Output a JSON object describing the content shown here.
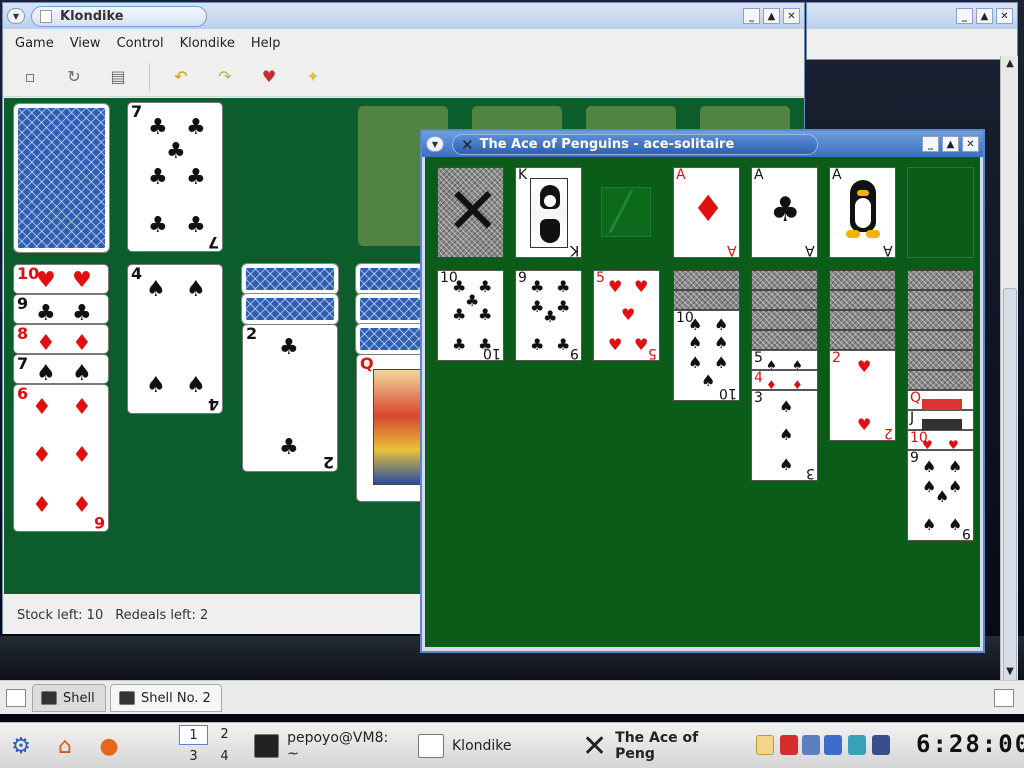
{
  "klondike": {
    "title": "Klondike",
    "menu": [
      "Game",
      "View",
      "Control",
      "Klondike",
      "Help"
    ],
    "toolbar_icons": [
      "new-game-icon",
      "restart-icon",
      "deal-icon",
      "undo-icon",
      "redo-icon",
      "hint-card-icon",
      "hint-bulb-icon"
    ],
    "status": {
      "stock": "Stock left: 10",
      "redeals": "Redeals left: 2"
    }
  },
  "ace": {
    "title": "The Ace of Penguins - ace-solitaire"
  },
  "cards": {
    "waste_7": "7",
    "col1_10": "10",
    "col1_9": "9",
    "col1_8": "8",
    "col1_7": "7",
    "col1_6": "6",
    "col2_4": "4",
    "col3_2": "2",
    "col4_q": "Q",
    "ace_k": "K",
    "ace_fA1": "A",
    "ace_fA2": "A",
    "ace_fA3": "A",
    "ace_c1": "10",
    "ace_c2": "9",
    "ace_c3": "5",
    "ace_c4": "10",
    "ace_c5a": "5",
    "ace_c5b": "4",
    "ace_c5c": "3",
    "ace_c6": "2",
    "ace_c7a": "Q",
    "ace_c7b": "J",
    "ace_c7c": "10",
    "ace_c7d": "9"
  },
  "tabs": [
    "Shell",
    "Shell No. 2"
  ],
  "taskbar": {
    "pager": [
      "1",
      "2",
      "3",
      "4"
    ],
    "tasks": [
      "pepoyo@VM8: ~",
      "Klondike",
      "The Ace of Peng"
    ],
    "clock": "6:28:00"
  },
  "colors": {
    "felt": "#0d5d2c",
    "ace_felt": "#0a5c18",
    "title_active": "#3c6fc0",
    "red_suit": "#e01010"
  }
}
